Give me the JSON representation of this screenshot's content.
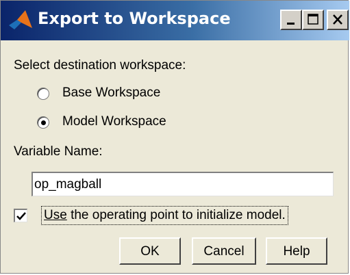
{
  "window": {
    "title": "Export to Workspace",
    "caption_buttons": [
      "minimize",
      "maximize",
      "close"
    ]
  },
  "destination": {
    "heading": "Select destination workspace:",
    "options": [
      {
        "label": "Base Workspace",
        "selected": false
      },
      {
        "label": "Model Workspace",
        "selected": true
      }
    ]
  },
  "variable": {
    "label": "Variable Name:",
    "value": "op_magball"
  },
  "init_checkbox": {
    "label_underlined": "Use",
    "label_rest": " the operating point to initialize model.",
    "checked": true
  },
  "buttons": {
    "ok": "OK",
    "cancel": "Cancel",
    "help": "Help"
  },
  "icons": {
    "title": "matlab-logo-icon",
    "minimize": "minimize-icon",
    "maximize": "maximize-icon",
    "close": "close-icon",
    "check": "check-icon"
  }
}
